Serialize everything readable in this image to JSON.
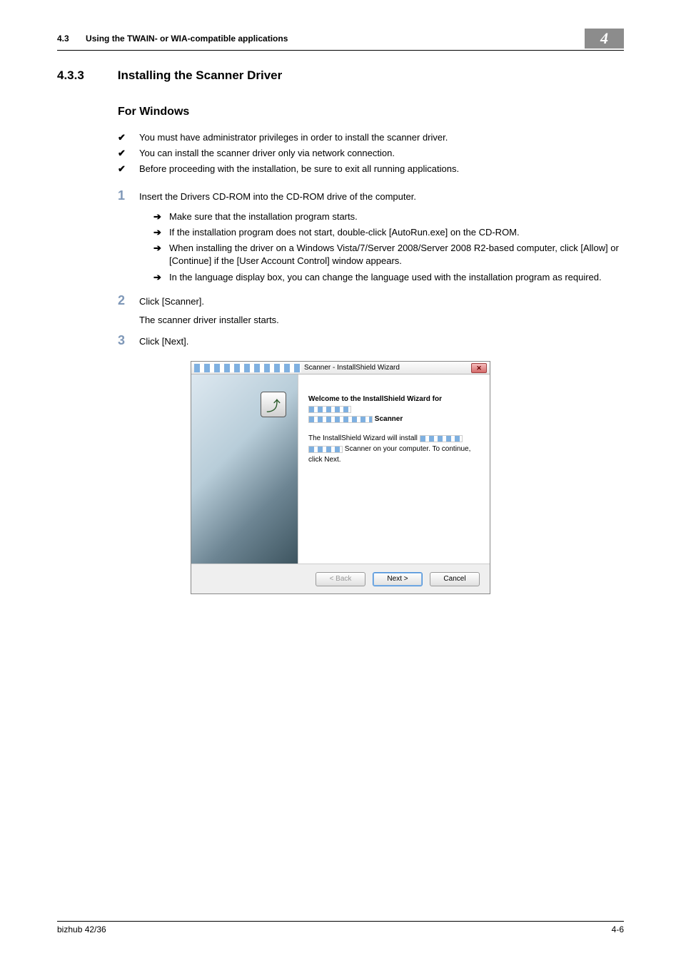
{
  "header": {
    "section_num": "4.3",
    "section_title": "Using the TWAIN- or WIA-compatible applications",
    "chapter": "4"
  },
  "heading": {
    "num": "4.3.3",
    "title": "Installing the Scanner Driver"
  },
  "subheading": "For Windows",
  "prereqs": [
    "You must have administrator privileges in order to install the scanner driver.",
    "You can install the scanner driver only via network connection.",
    "Before proceeding with the installation, be sure to exit all running applications."
  ],
  "steps": {
    "s1": {
      "num": "1",
      "text": "Insert the Drivers CD-ROM into the CD-ROM drive of the computer.",
      "sub": [
        "Make sure that the installation program starts.",
        "If the installation program does not start, double-click [AutoRun.exe] on the CD-ROM.",
        "When installing the driver on a Windows Vista/7/Server 2008/Server 2008 R2-based computer, click [Allow] or [Continue] if the [User Account Control] window appears.",
        "In the language display box, you can change the language used with the installation program as required."
      ]
    },
    "s2": {
      "num": "2",
      "text": "Click [Scanner].",
      "after": "The scanner driver installer starts."
    },
    "s3": {
      "num": "3",
      "text": "Click [Next]."
    }
  },
  "dialog": {
    "title": "Scanner - InstallShield Wizard",
    "welcome_prefix": "Welcome to the InstallShield Wizard for",
    "welcome_suffix": "Scanner",
    "desc_prefix": "The InstallShield Wizard will install",
    "desc_suffix": "Scanner on your computer.  To continue, click Next.",
    "buttons": {
      "back": "< Back",
      "next": "Next >",
      "cancel": "Cancel"
    },
    "close": "✕"
  },
  "footer": {
    "product": "bizhub 42/36",
    "page": "4-6"
  }
}
